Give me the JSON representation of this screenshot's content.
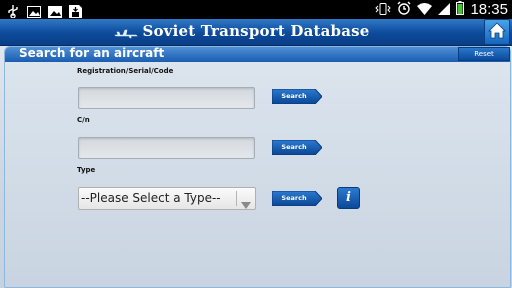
{
  "status_bar": {
    "time": "18:35"
  },
  "app": {
    "title": "Soviet Transport Database"
  },
  "panel": {
    "title": "Search for an aircraft",
    "reset_label": "Reset"
  },
  "form": {
    "registration": {
      "label": "Registration/Serial/Code",
      "value": "",
      "search_label": "Search"
    },
    "cn": {
      "label": "C/n",
      "value": "",
      "search_label": "Search"
    },
    "type": {
      "label": "Type",
      "selected": "--Please Select a Type--",
      "search_label": "Search",
      "info_label": "i"
    }
  },
  "colors": {
    "accent": "#1a5cb0",
    "title_bar": "#0d4a9a",
    "background": "#cbd6e2"
  }
}
